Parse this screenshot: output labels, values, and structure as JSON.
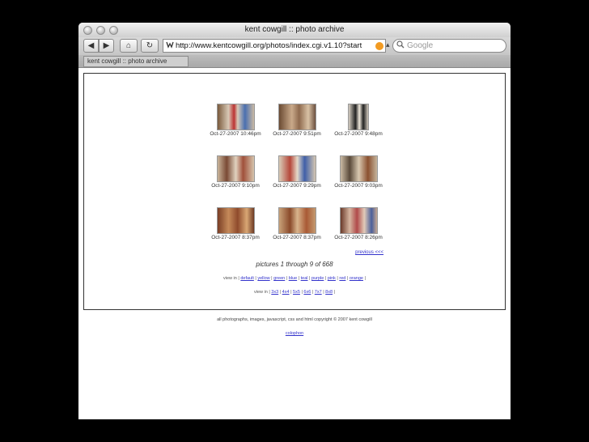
{
  "window": {
    "title": "kent cowgill :: photo archive"
  },
  "toolbar": {
    "back": "◀",
    "forward": "▶",
    "home": "⌂",
    "reload": "↻",
    "address": "http://www.kentcowgill.org/photos/index.cgi.v1.10?start",
    "search_placeholder": "Google"
  },
  "tab": {
    "label": "kent cowgill :: photo archive"
  },
  "gallery": {
    "photos": [
      {
        "date": "Oct-27-2007 10:46pm"
      },
      {
        "date": "Oct-27-2007 9:51pm"
      },
      {
        "date": "Oct-27-2007 9:48pm"
      },
      {
        "date": "Oct-27-2007 9:10pm"
      },
      {
        "date": "Oct-27-2007 9:29pm"
      },
      {
        "date": "Oct-27-2007 9:03pm"
      },
      {
        "date": "Oct-27-2007 8:37pm"
      },
      {
        "date": "Oct-27-2007 8:37pm"
      },
      {
        "date": "Oct-27-2007 8:26pm"
      }
    ],
    "previous_label": "previous <<<",
    "count_text": "pictures 1 through 9 of 668",
    "view_label": "view in",
    "themes": [
      "default",
      "yellow",
      "green",
      "blue",
      "teal",
      "purple",
      "pink",
      "red",
      "orange"
    ],
    "sizes": [
      "3x3",
      "4x4",
      "5x5",
      "6x6",
      "7x7",
      "8x8"
    ]
  },
  "footer": {
    "copyright": "all photographs, images, javascript, css and html copyright © 2007 kent cowgill",
    "colophon": "colophon"
  }
}
